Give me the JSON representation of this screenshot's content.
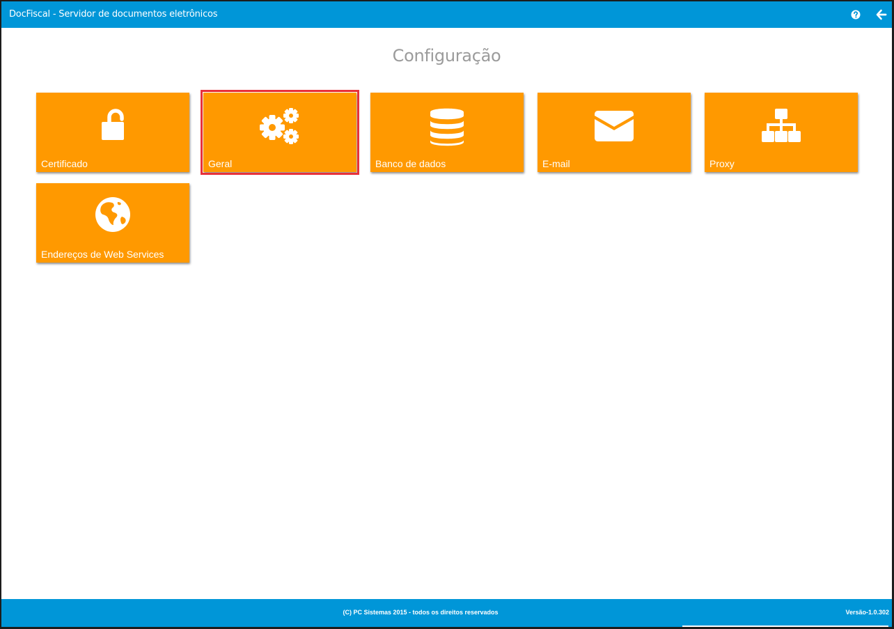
{
  "header": {
    "title": "DocFiscal - Servidor de documentos eletrônicos",
    "help_icon": "question-circle-icon",
    "back_icon": "arrow-left-icon"
  },
  "main": {
    "title": "Configuração",
    "tiles": [
      {
        "label": "Certificado",
        "icon": "unlock-icon",
        "selected": false
      },
      {
        "label": "Geral",
        "icon": "gears-icon",
        "selected": true
      },
      {
        "label": "Banco de dados",
        "icon": "database-icon",
        "selected": false
      },
      {
        "label": "E-mail",
        "icon": "envelope-icon",
        "selected": false
      },
      {
        "label": "Proxy",
        "icon": "sitemap-icon",
        "selected": false
      },
      {
        "label": "Endereços de Web Services",
        "icon": "globe-icon",
        "selected": false
      }
    ]
  },
  "footer": {
    "copyright": "(C) PC Sistemas 2015 - todos os direitos reservados",
    "version": "Versão-1.0.302"
  },
  "colors": {
    "header_bg": "#0096d8",
    "tile_bg": "#ff9900",
    "selection_outline": "#e8313a",
    "title_text": "#9b9b9b"
  }
}
